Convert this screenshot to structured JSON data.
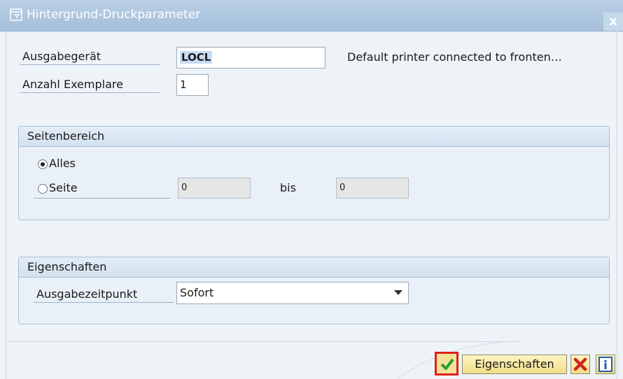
{
  "window": {
    "title": "Hintergrund-Druckparameter",
    "close_glyph": "x"
  },
  "output_device": {
    "label": "Ausgabegerät",
    "value": "LOCL",
    "description": "Default printer connected to fronten…"
  },
  "copies": {
    "label": "Anzahl Exemplare",
    "value": "1"
  },
  "page_range": {
    "title": "Seitenbereich",
    "option_all": "Alles",
    "option_page": "Seite",
    "selected": "Alles",
    "from_value": "0",
    "to_label": "bis",
    "to_value": "0"
  },
  "properties": {
    "title": "Eigenschaften",
    "output_time_label": "Ausgabezeitpunkt",
    "output_time_value": "Sofort"
  },
  "footer": {
    "ok_icon": "checkmark-icon",
    "properties_button": "Eigenschaften",
    "cancel_icon": "close-x-icon",
    "info_icon": "info-icon"
  },
  "colors": {
    "title_bar": "#a4bfdb",
    "accent_red": "#e0201c",
    "button_yellow": "#f2de86"
  }
}
